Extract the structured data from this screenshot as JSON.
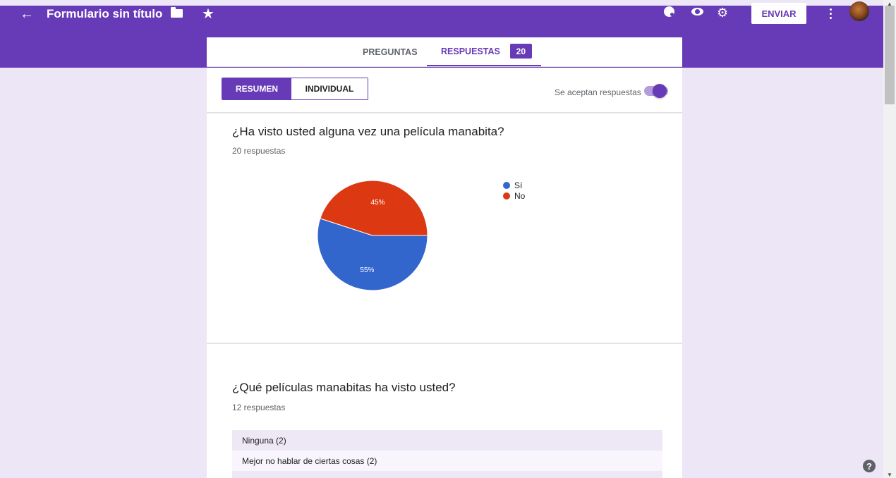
{
  "header": {
    "back_icon": "arrow-left-icon",
    "form_title": "Formulario sin título",
    "folder_icon": "folder-icon",
    "star_icon": "star-icon",
    "palette_icon": "palette-icon",
    "preview_icon": "eye-icon",
    "settings_icon": "gear-icon",
    "send_label": "ENVIAR",
    "more_icon": "more-vert-icon",
    "accent_color": "#673ab7"
  },
  "tabs": {
    "questions_label": "PREGUNTAS",
    "responses_label": "RESPUESTAS",
    "responses_count": "20"
  },
  "summary_controls": {
    "summary_label": "RESUMEN",
    "individual_label": "INDIVIDUAL",
    "accepting_label": "Se aceptan respuestas",
    "accepting_on": true
  },
  "question1": {
    "title": "¿Ha visto usted alguna vez una película manabita?",
    "response_count": "20 respuestas",
    "chart_data": {
      "type": "pie",
      "slices": [
        {
          "label": "Sí",
          "value": 55,
          "percent_label": "55%",
          "color": "#3366cc"
        },
        {
          "label": "No",
          "value": 45,
          "percent_label": "45%",
          "color": "#dc3912"
        }
      ],
      "legend_position": "right"
    }
  },
  "question2": {
    "title": "¿Qué películas manabitas ha visto usted?",
    "response_count": "12 respuestas",
    "answers": [
      "Ninguna (2)",
      "Mejor no hablar de ciertas cosas (2)",
      ""
    ]
  },
  "help": {
    "label": "?",
    "icon": "help-icon"
  }
}
